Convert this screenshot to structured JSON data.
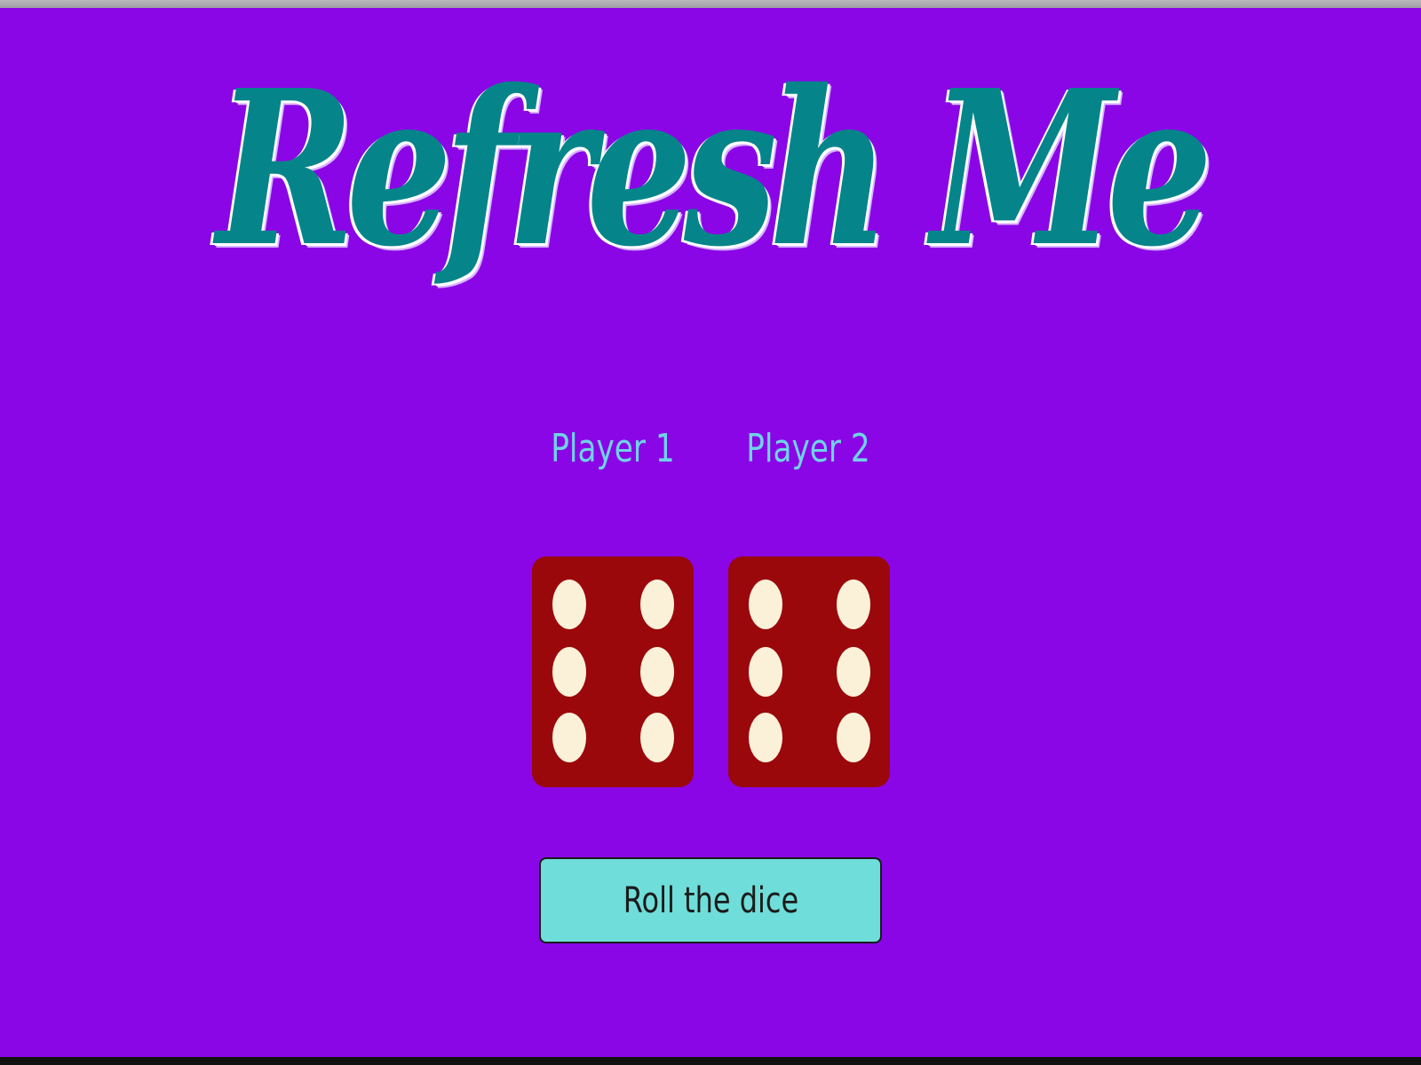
{
  "title": "Refresh Me",
  "players": [
    {
      "label": "Player 1",
      "die_value": 6
    },
    {
      "label": "Player 2",
      "die_value": 6
    }
  ],
  "roll_button": {
    "label": "Roll the dice"
  },
  "colors": {
    "background": "#8a06e6",
    "title": "#05858a",
    "player_label": "#6fd3e6",
    "die": "#9a080b",
    "pip": "#fbf1d8",
    "button": "#6fddd9"
  }
}
